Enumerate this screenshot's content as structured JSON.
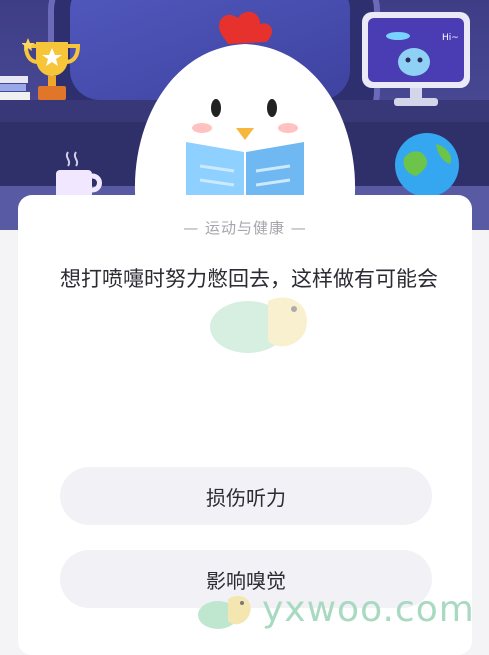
{
  "question": {
    "category": "— 运动与健康 —",
    "text": "想打喷嚏时努力憋回去，这样做有可能会"
  },
  "options": [
    {
      "label": "损伤听力"
    },
    {
      "label": "影响嗅觉"
    }
  ],
  "scene": {
    "monitor_bubble": "Hi~"
  },
  "watermark": {
    "logo_text": "yxwoo.com"
  },
  "colors": {
    "background": "#f4f4f7",
    "card": "#ffffff",
    "option_bg": "#f2f2f6",
    "text": "#2b2b33",
    "category_text": "#a5a5ad",
    "scene_bg": "#44448f",
    "watermark": "#a9d9c1"
  },
  "icons": [
    "trophy-icon",
    "books-icon",
    "monitor-alien-icon",
    "globe-icon",
    "mug-icon",
    "chick-mascot",
    "snail-logo-icon"
  ]
}
